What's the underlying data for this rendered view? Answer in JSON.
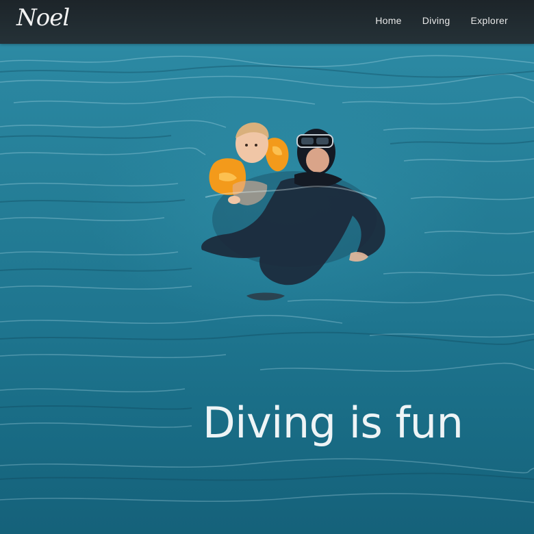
{
  "navbar": {
    "brand": "Noel",
    "links": [
      {
        "label": "Home"
      },
      {
        "label": "Diving"
      },
      {
        "label": "Explorer"
      }
    ]
  },
  "hero": {
    "headline": "Diving is fun",
    "image_description_icon": "swimmers-photo"
  },
  "colors": {
    "navbar_bg": "#23282c",
    "water": "#1f7690",
    "text": "#eef4f6",
    "float": "#f39a1b",
    "wetsuit": "#1e2a3a"
  }
}
